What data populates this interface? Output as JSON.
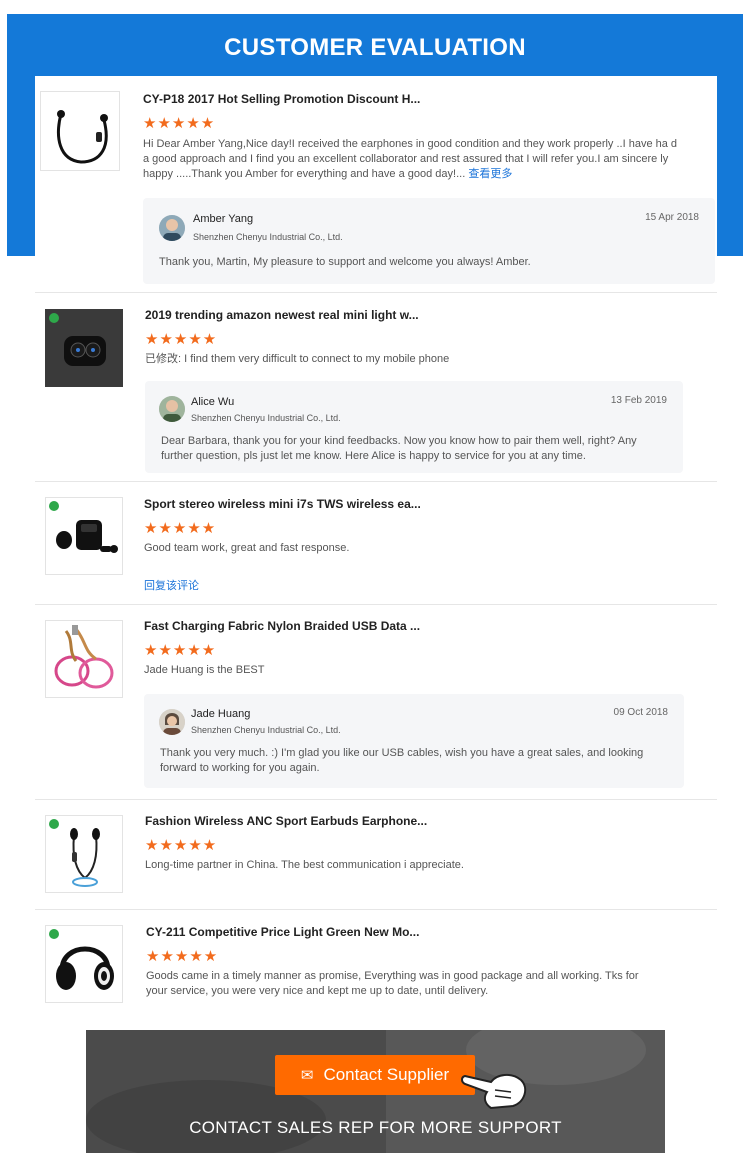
{
  "banner": {
    "title": "CUSTOMER EVALUATION"
  },
  "reviews": [
    {
      "product": "CY-P18 2017 Hot Selling Promotion Discount H...",
      "stars": "★★★★★",
      "text": "Hi Dear Amber Yang,Nice day!I received the earphones in good condition and they work properly ..I have ha d a good approach and I find you an excellent collaborator and rest assured that I will refer you.I am sincere ly happy .....Thank you Amber for everything and have a good day!...",
      "more": "查看更多",
      "reply": {
        "name": "Amber Yang",
        "company": "Shenzhen Chenyu Industrial Co., Ltd.",
        "date": "15 Apr 2018",
        "message": "Thank you, Martin, My pleasure to support and welcome you always! Amber."
      }
    },
    {
      "product": "2019 trending amazon newest real mini light w...",
      "stars": "★★★★★",
      "text": "已修改: I find them very difficult to connect to my mobile phone",
      "reply": {
        "name": "Alice Wu",
        "company": "Shenzhen Chenyu Industrial Co., Ltd.",
        "date": "13 Feb 2019",
        "message": "Dear Barbara, thank you for your kind feedbacks. Now you know how to pair them well, right? Any further question, pls just let me know. Here Alice is happy to service for you at any time."
      }
    },
    {
      "product": "Sport stereo wireless mini i7s TWS wireless ea...",
      "stars": "★★★★★",
      "text": "Good team work, great and fast response.",
      "reply_link": "回复该评论"
    },
    {
      "product": "Fast Charging Fabric Nylon Braided USB Data ...",
      "stars": "★★★★★",
      "text": "Jade Huang is the BEST",
      "reply": {
        "name": "Jade Huang",
        "company": "Shenzhen Chenyu Industrial Co., Ltd.",
        "date": "09 Oct 2018",
        "message": "Thank you very much. :) I'm glad you like our USB cables, wish you have a great sales, and looking forward to working for you again."
      }
    },
    {
      "product": "Fashion Wireless ANC Sport Earbuds Earphone...",
      "stars": "★★★★★",
      "text": "Long-time partner in China. The best communication i appreciate."
    },
    {
      "product": "CY-211 Competitive Price Light Green New Mo...",
      "stars": "★★★★★",
      "text": "Goods came in a timely manner as promise, Everything was in good package and all working. Tks for your service, you were very nice and kept me up to date, until delivery."
    }
  ],
  "footer": {
    "button_label": "Contact Supplier",
    "tagline": "CONTACT SALES REP FOR MORE SUPPORT"
  },
  "colors": {
    "banner": "#1479d8",
    "stars": "#f26b1d",
    "link": "#1a73d9",
    "button": "#ff6a00"
  },
  "icons": [
    "earphone-product-image",
    "earbuds-case-product-image",
    "tws-earbuds-product-image",
    "usb-cable-product-image",
    "sport-earbuds-product-image",
    "headphones-product-image",
    "avatar",
    "mail-icon",
    "pointing-hand-icon"
  ]
}
